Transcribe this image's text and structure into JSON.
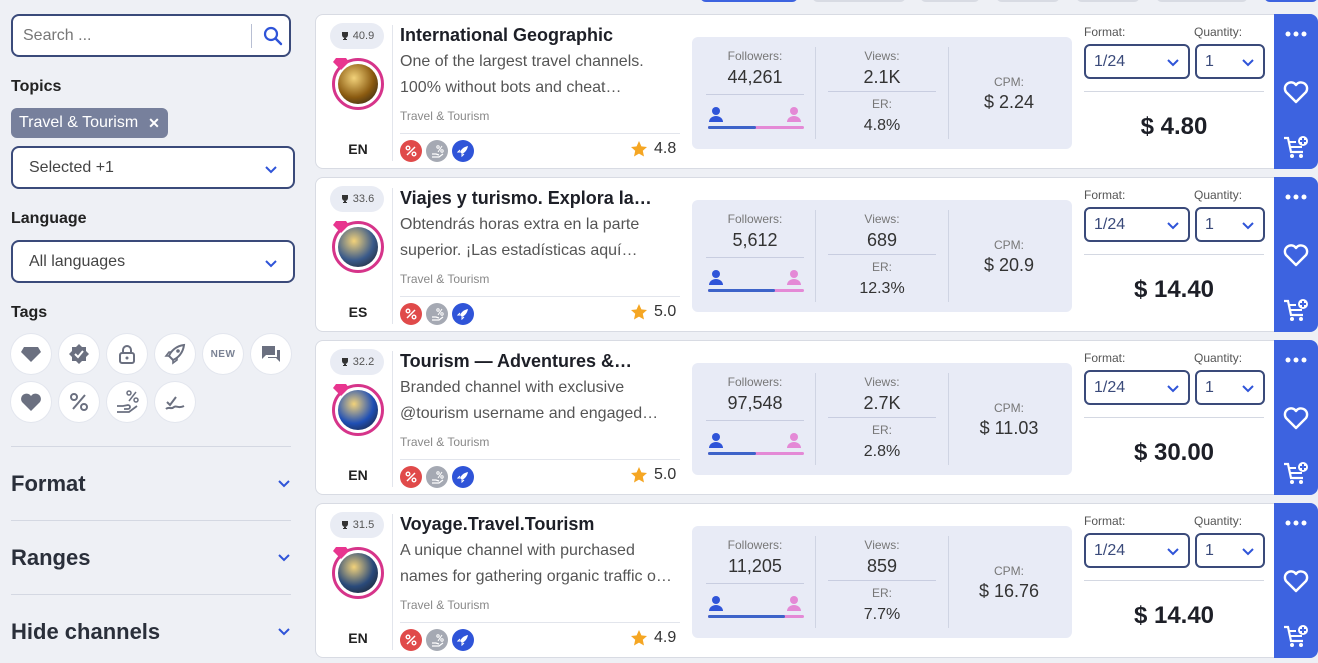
{
  "search": {
    "placeholder": "Search ..."
  },
  "filters": {
    "topics_label": "Topics",
    "topic_chip": "Travel & Tourism",
    "topic_select": "Selected +1",
    "language_label": "Language",
    "language_select": "All languages",
    "tags_label": "Tags",
    "new_tag": "NEW",
    "sections": [
      "Format",
      "Ranges",
      "Hide channels"
    ]
  },
  "card_labels": {
    "followers": "Followers:",
    "views": "Views:",
    "er": "ER:",
    "cpm": "CPM:",
    "format": "Format:",
    "quantity": "Quantity:"
  },
  "channels": [
    {
      "rank": "40.9",
      "title": "International Geographic",
      "desc1": "One of the largest travel channels.",
      "desc2": "100% without bots and cheat…",
      "category": "Travel & Tourism",
      "lang": "EN",
      "rating": "4.8",
      "followers": "44,261",
      "views": "2.1K",
      "er": "4.8%",
      "cpm": "$ 2.24",
      "male_share": 0.5,
      "format": "1/24",
      "quantity": "1",
      "price": "$ 4.80",
      "avatar_color": "#8a5a10"
    },
    {
      "rank": "33.6",
      "title": "Viajes y turismo. Explora la…",
      "desc1": "Obtendrás horas extra en la parte",
      "desc2": "superior. ¡Las estadísticas aquí…",
      "category": "Travel & Tourism",
      "lang": "ES",
      "rating": "5.0",
      "followers": "5,612",
      "views": "689",
      "er": "12.3%",
      "cpm": "$ 20.9",
      "male_share": 0.7,
      "format": "1/24",
      "quantity": "1",
      "price": "$ 14.40",
      "avatar_color": "#3a5a8a"
    },
    {
      "rank": "32.2",
      "title": "Tourism — Adventures &…",
      "desc1": "Branded channel with exclusive",
      "desc2": "@tourism username and engaged…",
      "category": "Travel & Tourism",
      "lang": "EN",
      "rating": "5.0",
      "followers": "97,548",
      "views": "2.7K",
      "er": "2.8%",
      "cpm": "$ 11.03",
      "male_share": 0.5,
      "format": "1/24",
      "quantity": "1",
      "price": "$ 30.00",
      "avatar_color": "#1f4fb5"
    },
    {
      "rank": "31.5",
      "title": "Voyage.Travel.Tourism",
      "desc1": "A unique channel with purchased",
      "desc2": "names for gathering organic traffic o…",
      "category": "Travel & Tourism",
      "lang": "EN",
      "rating": "4.9",
      "followers": "11,205",
      "views": "859",
      "er": "7.7%",
      "cpm": "$ 16.76",
      "male_share": 0.8,
      "format": "1/24",
      "quantity": "1",
      "price": "$ 14.40",
      "avatar_color": "#2a4a7a"
    }
  ]
}
